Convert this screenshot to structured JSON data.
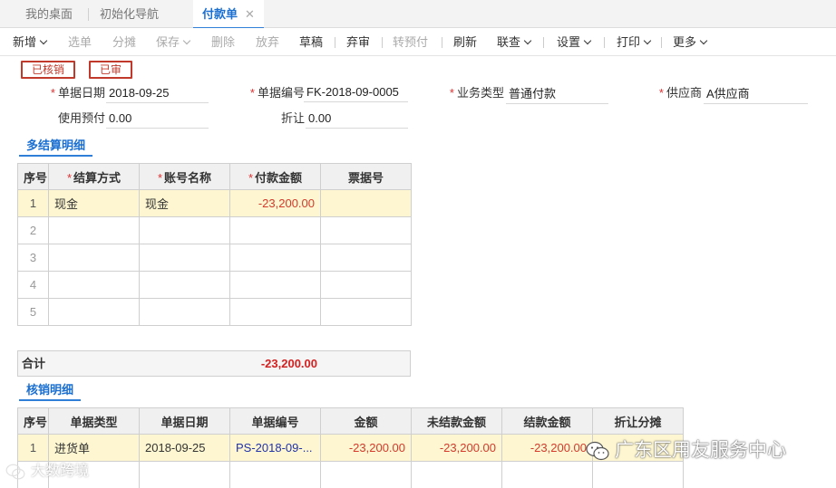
{
  "tabs": [
    {
      "label": "我的桌面"
    },
    {
      "label": "初始化导航"
    },
    {
      "label": "付款单",
      "close": "✕"
    }
  ],
  "toolbar": {
    "new": "新增",
    "select_source": "选单",
    "allocate": "分摊",
    "save": "保存",
    "delete": "删除",
    "abandon": "放弃",
    "draft": "草稿",
    "unapprove": "弃审",
    "to_prepaid": "转预付",
    "refresh": "刷新",
    "link_query": "联查",
    "settings": "设置",
    "print": "打印",
    "more": "更多"
  },
  "stamps": {
    "verified": "已核销",
    "approved": "已审"
  },
  "form": {
    "doc_date_label": "单据日期",
    "doc_date": "2018-09-25",
    "doc_no_label": "单据编号",
    "doc_no": "FK-2018-09-0005",
    "biz_type_label": "业务类型",
    "biz_type": "普通付款",
    "supplier_label": "供应商",
    "supplier": "A供应商",
    "prepaid_label": "使用预付",
    "prepaid": "0.00",
    "discount_label": "折让",
    "discount": "0.00"
  },
  "settlement": {
    "title": "多结算明细",
    "headers": [
      "序号",
      "结算方式",
      "账号名称",
      "付款金额",
      "票据号"
    ],
    "rows": [
      {
        "no": "1",
        "method": "现金",
        "account": "现金",
        "amount": "-23,200.00",
        "bill_no": ""
      },
      {
        "no": "2",
        "method": "",
        "account": "",
        "amount": "",
        "bill_no": ""
      },
      {
        "no": "3",
        "method": "",
        "account": "",
        "amount": "",
        "bill_no": ""
      },
      {
        "no": "4",
        "method": "",
        "account": "",
        "amount": "",
        "bill_no": ""
      },
      {
        "no": "5",
        "method": "",
        "account": "",
        "amount": "",
        "bill_no": ""
      }
    ],
    "total_label": "合计",
    "total_value": "-23,200.00"
  },
  "writeoff": {
    "title": "核销明细",
    "headers": [
      "序号",
      "单据类型",
      "单据日期",
      "单据编号",
      "金额",
      "未结款金额",
      "结款金额",
      "折让分摊"
    ],
    "rows": [
      {
        "no": "1",
        "type": "进货单",
        "date": "2018-09-25",
        "doc_no": "PS-2018-09-...",
        "amount": "-23,200.00",
        "unsettled": "-23,200.00",
        "settled": "-23,200.00",
        "discount_alloc": ""
      }
    ]
  },
  "watermarks": {
    "right": "广东区用友服务中心",
    "left": "大数跨境"
  },
  "colors": {
    "accent": "#2f7fd8",
    "required": "#e03030",
    "negative": "#d43a2c",
    "stamp": "#c0392b",
    "highlight_row": "#fdf6d0"
  }
}
